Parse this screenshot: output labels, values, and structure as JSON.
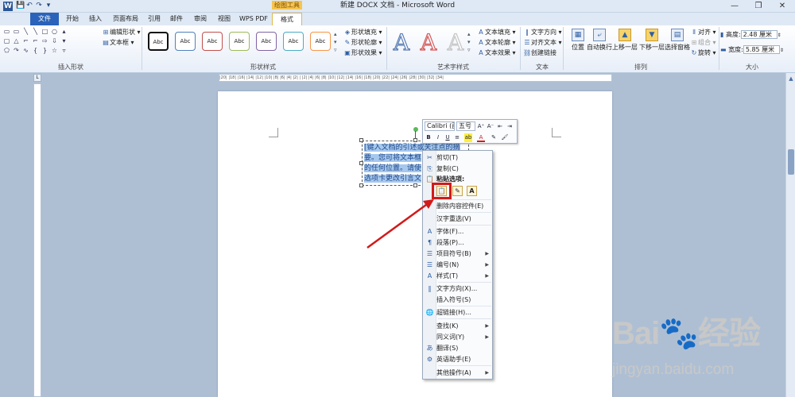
{
  "window": {
    "title": "新建 DOCX 文档 - Microsoft Word",
    "context_tab_group": "绘图工具",
    "controls": [
      "—",
      "❐",
      "✕"
    ]
  },
  "qat": [
    "💾",
    "↶",
    "↷",
    "▾"
  ],
  "tabs": [
    "文件",
    "开始",
    "插入",
    "页面布局",
    "引用",
    "邮件",
    "审阅",
    "视图",
    "WPS PDF",
    "格式"
  ],
  "ribbon": {
    "insert_shapes": {
      "label": "插入形状",
      "edit_shape": "编辑形状 ▾",
      "text_box": "文本框 ▾"
    },
    "shape_styles": {
      "label": "形状样式",
      "preset_text": "Abc",
      "fill": "形状填充 ▾",
      "outline": "形状轮廓 ▾",
      "effects": "形状效果 ▾"
    },
    "art_styles": {
      "label": "艺术字样式",
      "letters": [
        "A",
        "A",
        "A"
      ],
      "text_fill": "文本填充 ▾",
      "text_outline": "文本轮廓 ▾",
      "text_effects": "文本效果 ▾"
    },
    "text": {
      "label": "文本",
      "direction": "文字方向 ▾",
      "align": "对齐文本 ▾",
      "link": "创建链接"
    },
    "arrange": {
      "label": "排列",
      "position": "位置",
      "wrap": "自动换行",
      "bring_forward": "上移一层",
      "send_backward": "下移一层",
      "selection_pane": "选择窗格",
      "align": "对齐 ▾",
      "group": "组合 ▾",
      "rotate": "旋转 ▾"
    },
    "size": {
      "label": "大小",
      "height_label": "高度:",
      "height_value": "2.48 厘米",
      "width_label": "宽度:",
      "width_value": "5.85 厘米"
    }
  },
  "ruler": {
    "corner": "L",
    "ticks": "|20| |18| |16| |14| |12| |10| |8| |6| |4| |2| |  |2| |4| |6| |8| |10| |12| |14| |16| |18| |20| |22| |24| |26| |28| |30| |32| |34|"
  },
  "document": {
    "textbox_lines": [
      "[键入文档的引述或关注点的摘",
      "要。您可将文本框",
      "的任何位置。请使",
      "选项卡更改引言文"
    ]
  },
  "mini_toolbar": {
    "font": "Calibri (西",
    "size": "五号",
    "buttons_row1": [
      "A⁺",
      "A⁻",
      "⇤",
      "⇥"
    ],
    "buttons_row2": [
      "B",
      "I",
      "U",
      "≡",
      "ab",
      "A",
      "✎",
      "🖌"
    ]
  },
  "context_menu": {
    "items": [
      {
        "icon": "✂",
        "label": "剪切(T)"
      },
      {
        "icon": "⎘",
        "label": "复制(C)"
      },
      {
        "icon": "📋",
        "label": "粘贴选项:"
      },
      {
        "icon": "",
        "label": "删除内容控件(E)"
      },
      {
        "icon": "",
        "label": "汉字重选(V)"
      },
      {
        "icon": "A",
        "label": "字体(F)..."
      },
      {
        "icon": "¶",
        "label": "段落(P)..."
      },
      {
        "icon": "☰",
        "label": "项目符号(B)",
        "submenu": true
      },
      {
        "icon": "☰",
        "label": "编号(N)",
        "submenu": true
      },
      {
        "icon": "A",
        "label": "样式(T)",
        "submenu": true
      },
      {
        "icon": "‖",
        "label": "文字方向(X)..."
      },
      {
        "icon": "",
        "label": "插入符号(S)"
      },
      {
        "icon": "🌐",
        "label": "超链接(H)..."
      },
      {
        "icon": "",
        "label": "查找(K)",
        "submenu": true
      },
      {
        "icon": "",
        "label": "同义词(Y)",
        "submenu": true
      },
      {
        "icon": "あ",
        "label": "翻译(S)"
      },
      {
        "icon": "⚙",
        "label": "英语助手(E)"
      },
      {
        "icon": "",
        "label": "其他操作(A)",
        "submenu": true
      }
    ],
    "paste_options": [
      "📋",
      "✎",
      "A"
    ]
  },
  "watermark": {
    "logo": "Bai🐾经验",
    "url": "jingyan.baidu.com"
  },
  "colors": {
    "file_tab": "#2a63b9",
    "context_tab": "#f6c451",
    "annotation_red": "#d21a1a",
    "selection": "#a6c8ee"
  }
}
